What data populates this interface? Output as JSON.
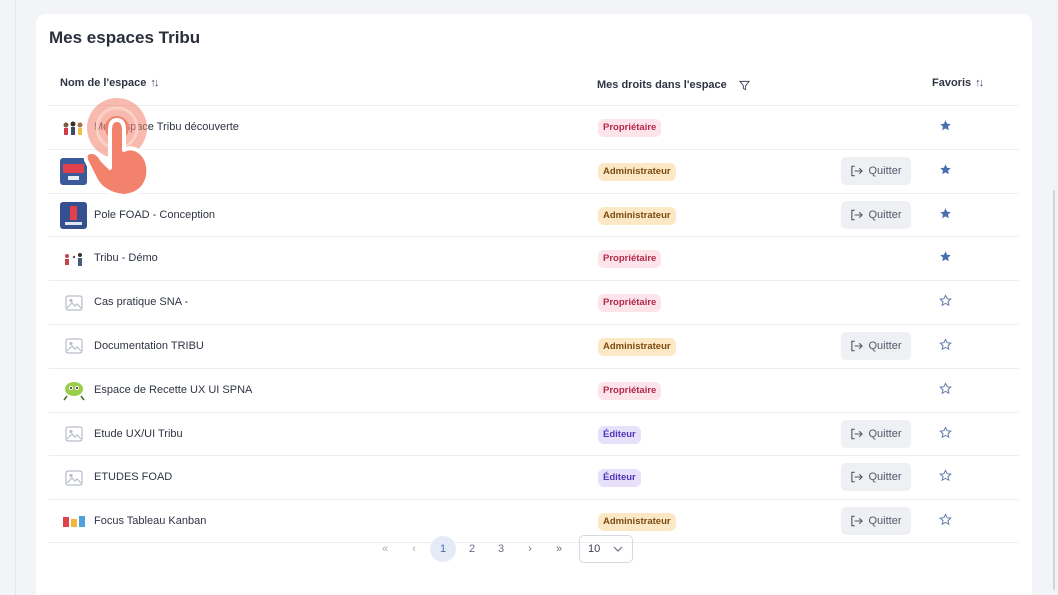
{
  "card": {
    "title": "Mes espaces Tribu"
  },
  "table": {
    "headers": {
      "name": "Nom de l'espace",
      "rights": "Mes droits dans l'espace",
      "favorites": "Favoris"
    },
    "rows": [
      {
        "name": "Mon espace Tribu découverte",
        "role": "Propriétaire",
        "role_type": "proprietaire",
        "quit": "",
        "favorite": true,
        "thumb": "people"
      },
      {
        "name": "P",
        "role": "Administrateur",
        "role_type": "administrateur",
        "quit": "Quitter",
        "favorite": true,
        "thumb": "card-blue"
      },
      {
        "name": "Pole FOAD - Conception",
        "role": "Administrateur",
        "role_type": "administrateur",
        "quit": "Quitter",
        "favorite": true,
        "thumb": "poster-blue"
      },
      {
        "name": "Tribu - Démo",
        "role": "Propriétaire",
        "role_type": "proprietaire",
        "quit": "",
        "favorite": true,
        "thumb": "people-small"
      },
      {
        "name": "Cas pratique SNA -",
        "role": "Propriétaire",
        "role_type": "proprietaire",
        "quit": "",
        "favorite": false,
        "thumb": "placeholder"
      },
      {
        "name": "Documentation TRIBU",
        "role": "Administrateur",
        "role_type": "administrateur",
        "quit": "Quitter",
        "favorite": false,
        "thumb": "placeholder"
      },
      {
        "name": "Espace de Recette UX UI SPNA",
        "role": "Propriétaire",
        "role_type": "proprietaire",
        "quit": "",
        "favorite": false,
        "thumb": "mascot"
      },
      {
        "name": "Etude UX/UI Tribu",
        "role": "Éditeur",
        "role_type": "editeur",
        "quit": "Quitter",
        "favorite": false,
        "thumb": "placeholder"
      },
      {
        "name": "ETUDES FOAD",
        "role": "Éditeur",
        "role_type": "editeur",
        "quit": "Quitter",
        "favorite": false,
        "thumb": "placeholder"
      },
      {
        "name": "Focus Tableau Kanban",
        "role": "Administrateur",
        "role_type": "administrateur",
        "quit": "Quitter",
        "favorite": false,
        "thumb": "kanban"
      }
    ]
  },
  "pagination": {
    "first": "«",
    "prev": "‹",
    "pages": [
      "1",
      "2",
      "3"
    ],
    "current": "1",
    "next": "›",
    "last": "»",
    "page_size": "10"
  },
  "colors": {
    "star_filled": "#4a6fb0",
    "proprietaire_bg": "#fde4ea",
    "administrateur_bg": "#fde8c6",
    "editeur_bg": "#e6e0fb",
    "tap_indicator": "#f3826d"
  }
}
